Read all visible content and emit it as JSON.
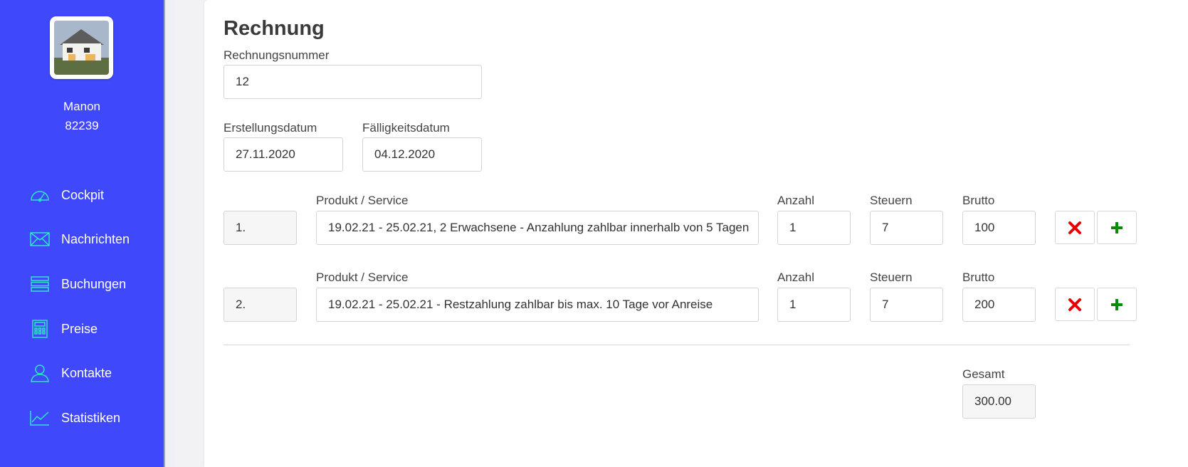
{
  "user": {
    "name": "Manon",
    "id": "82239"
  },
  "nav": [
    {
      "label": "Cockpit",
      "icon": "speedometer-icon"
    },
    {
      "label": "Nachrichten",
      "icon": "envelope-icon"
    },
    {
      "label": "Buchungen",
      "icon": "list-icon"
    },
    {
      "label": "Preise",
      "icon": "calculator-icon"
    },
    {
      "label": "Kontakte",
      "icon": "user-icon"
    },
    {
      "label": "Statistiken",
      "icon": "chart-line-icon"
    }
  ],
  "invoice": {
    "title": "Rechnung",
    "number_label": "Rechnungsnummer",
    "number_value": "12",
    "created_label": "Erstellungsdatum",
    "created_value": "27.11.2020",
    "due_label": "Fälligkeitsdatum",
    "due_value": "04.12.2020",
    "col_product": "Produkt / Service",
    "col_qty": "Anzahl",
    "col_tax": "Steuern",
    "col_gross": "Brutto",
    "items": [
      {
        "pos": "1.",
        "product": "19.02.21 - 25.02.21, 2 Erwachsene - Anzahlung zahlbar innerhalb von 5 Tagen",
        "qty": "1",
        "tax": "7",
        "gross": "100"
      },
      {
        "pos": "2.",
        "product": "19.02.21 - 25.02.21 - Restzahlung zahlbar bis max. 10 Tage vor Anreise",
        "qty": "1",
        "tax": "7",
        "gross": "200"
      }
    ],
    "total_label": "Gesamt",
    "total_value": "300.00"
  },
  "colors": {
    "sidebar": "#3f48fb",
    "icon_accent": "#2ee6c7",
    "remove": "#e60000",
    "add": "#0a8a0a"
  }
}
